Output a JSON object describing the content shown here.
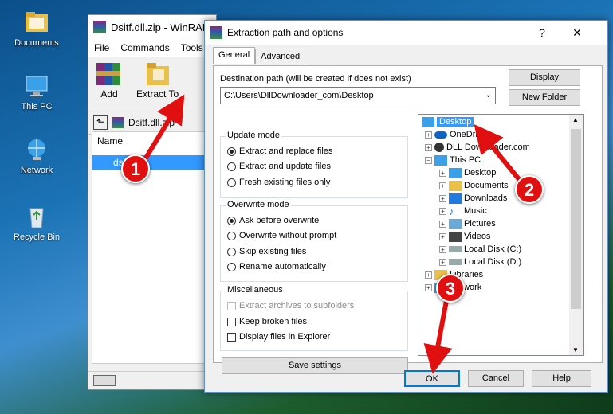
{
  "desktop": {
    "icons": [
      {
        "label": "Documents",
        "icon": "folder-icon"
      },
      {
        "label": "This PC",
        "icon": "computer-icon"
      },
      {
        "label": "Network",
        "icon": "network-icon"
      },
      {
        "label": "Recycle Bin",
        "icon": "recycle-bin-icon"
      }
    ]
  },
  "winrar": {
    "title": "Dsitf.dll.zip - WinRAR",
    "menu": [
      "File",
      "Commands",
      "Tools"
    ],
    "toolbar": {
      "add_label": "Add",
      "extract_label": "Extract To"
    },
    "address": "Dsitf.dll.zip",
    "column_name": "Name",
    "row_text": "dsitf.dll"
  },
  "dialog": {
    "title": "Extraction path and options",
    "help_glyph": "?",
    "close_glyph": "✕",
    "tabs": [
      "General",
      "Advanced"
    ],
    "dest_label": "Destination path (will be created if does not exist)",
    "dest_value": "C:\\Users\\DllDownloader_com\\Desktop",
    "display_button": "Display",
    "new_folder_button": "New Folder",
    "update_mode": {
      "label": "Update mode",
      "options": [
        "Extract and replace files",
        "Extract and update files",
        "Fresh existing files only"
      ]
    },
    "overwrite_mode": {
      "label": "Overwrite mode",
      "options": [
        "Ask before overwrite",
        "Overwrite without prompt",
        "Skip existing files",
        "Rename automatically"
      ]
    },
    "misc": {
      "label": "Miscellaneous",
      "options": [
        "Extract archives to subfolders",
        "Keep broken files",
        "Display files in Explorer"
      ]
    },
    "save_settings": "Save settings",
    "tree": {
      "root": "Desktop",
      "items": [
        "OneDrive",
        "DLL Downloader.com",
        "This PC",
        "Desktop",
        "Documents",
        "Downloads",
        "Music",
        "Pictures",
        "Videos",
        "Local Disk (C:)",
        "Local Disk (D:)",
        "Libraries",
        "Network"
      ]
    },
    "ok_button": "OK",
    "cancel_button": "Cancel",
    "help_button": "Help"
  },
  "markers": [
    "1",
    "2",
    "3"
  ],
  "colors": {
    "selection": "#3399ff",
    "marker": "#e01010",
    "arrow": "#e01010"
  }
}
